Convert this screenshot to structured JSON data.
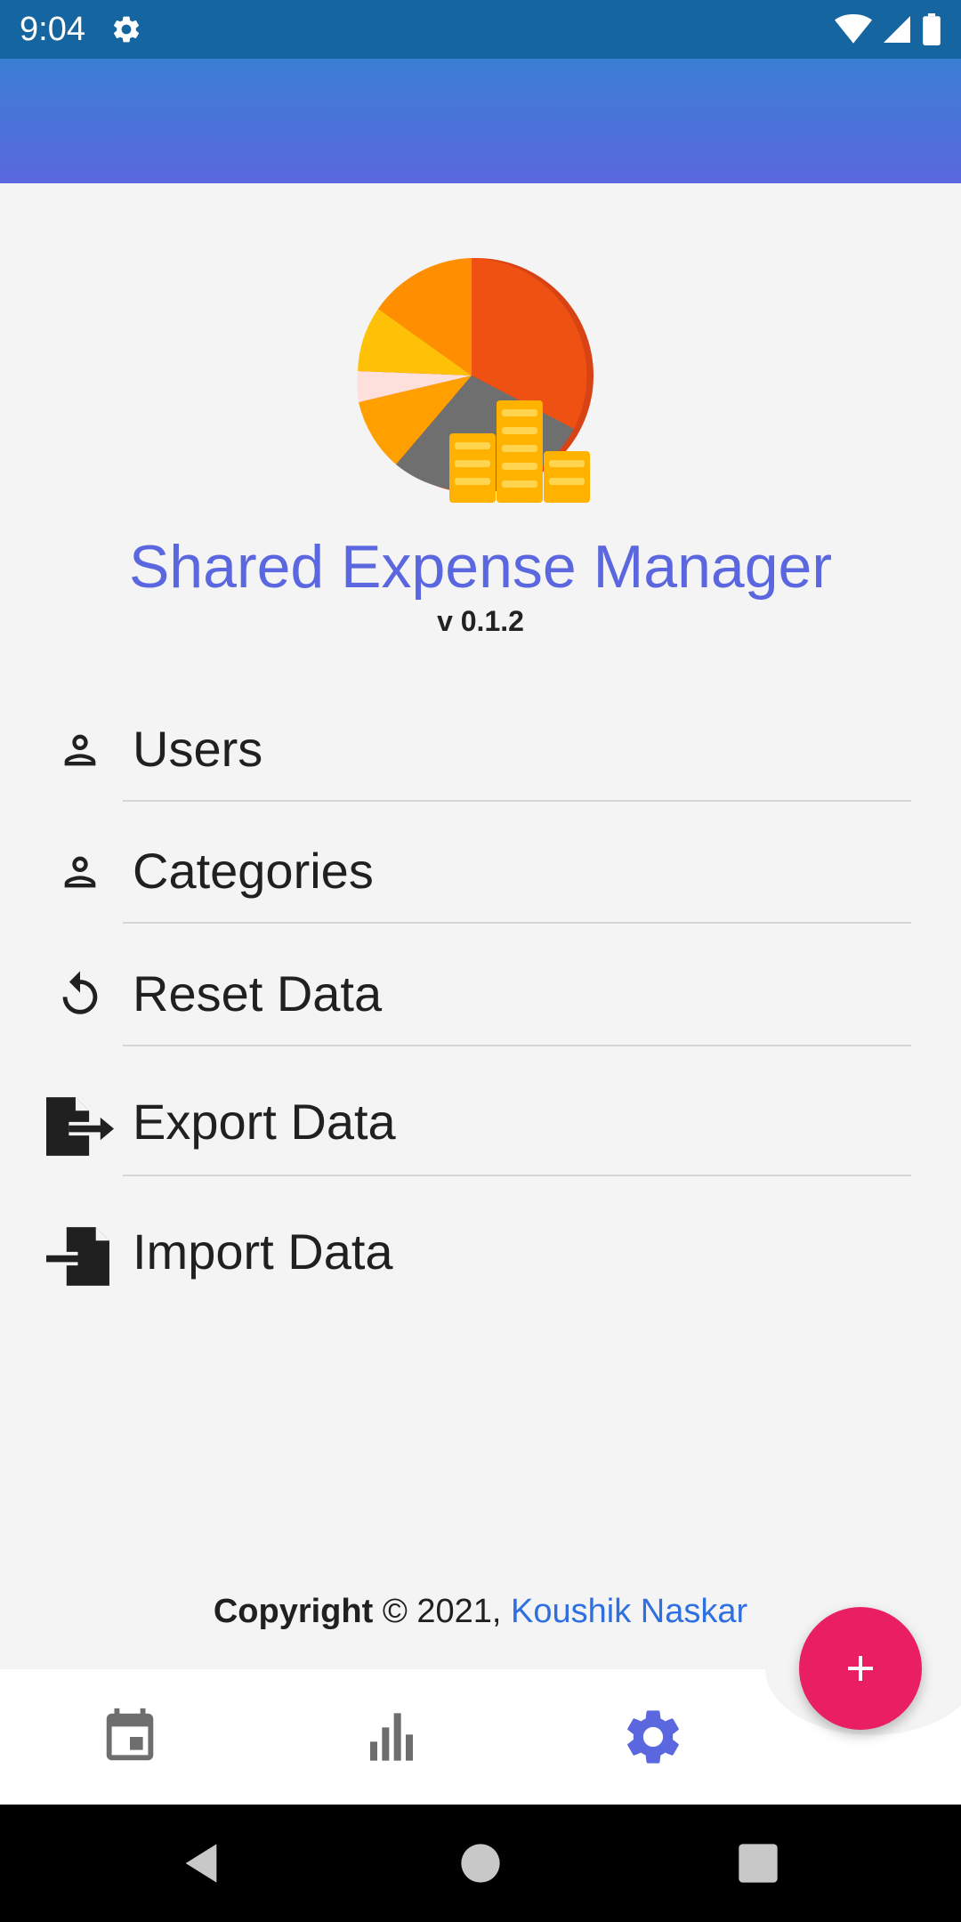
{
  "status_bar": {
    "time": "9:04",
    "settings_icon": "gear-icon",
    "wifi_icon": "wifi-icon",
    "signal_icon": "signal-icon",
    "battery_icon": "battery-icon"
  },
  "app": {
    "title": "Shared Expense Manager",
    "version": "v 0.1.2",
    "accent_color": "#5b67de",
    "header_gradient": [
      "#3a7fd4",
      "#5b67de"
    ]
  },
  "menu": {
    "items": [
      {
        "label": "Users",
        "icon": "person-icon"
      },
      {
        "label": "Categories",
        "icon": "person-icon"
      },
      {
        "label": "Reset Data",
        "icon": "restore-icon"
      },
      {
        "label": "Export Data",
        "icon": "file-export-icon"
      },
      {
        "label": "Import Data",
        "icon": "file-import-icon"
      }
    ]
  },
  "footer": {
    "copyright_label": "Copyright",
    "copyright_text": "© 2021,",
    "author": "Koushik Naskar",
    "author_color": "#2f6fe0"
  },
  "bottom_nav": {
    "items": [
      {
        "icon": "calendar-icon",
        "active": false
      },
      {
        "icon": "bar-chart-icon",
        "active": false
      },
      {
        "icon": "gear-icon",
        "active": true
      }
    ],
    "active_color": "#5b67de",
    "inactive_color": "#6e6e6e"
  },
  "fab": {
    "icon": "plus-icon",
    "color": "#e91e63"
  },
  "system_nav": {
    "back": "back-icon",
    "home": "home-icon",
    "recents": "recents-icon"
  }
}
